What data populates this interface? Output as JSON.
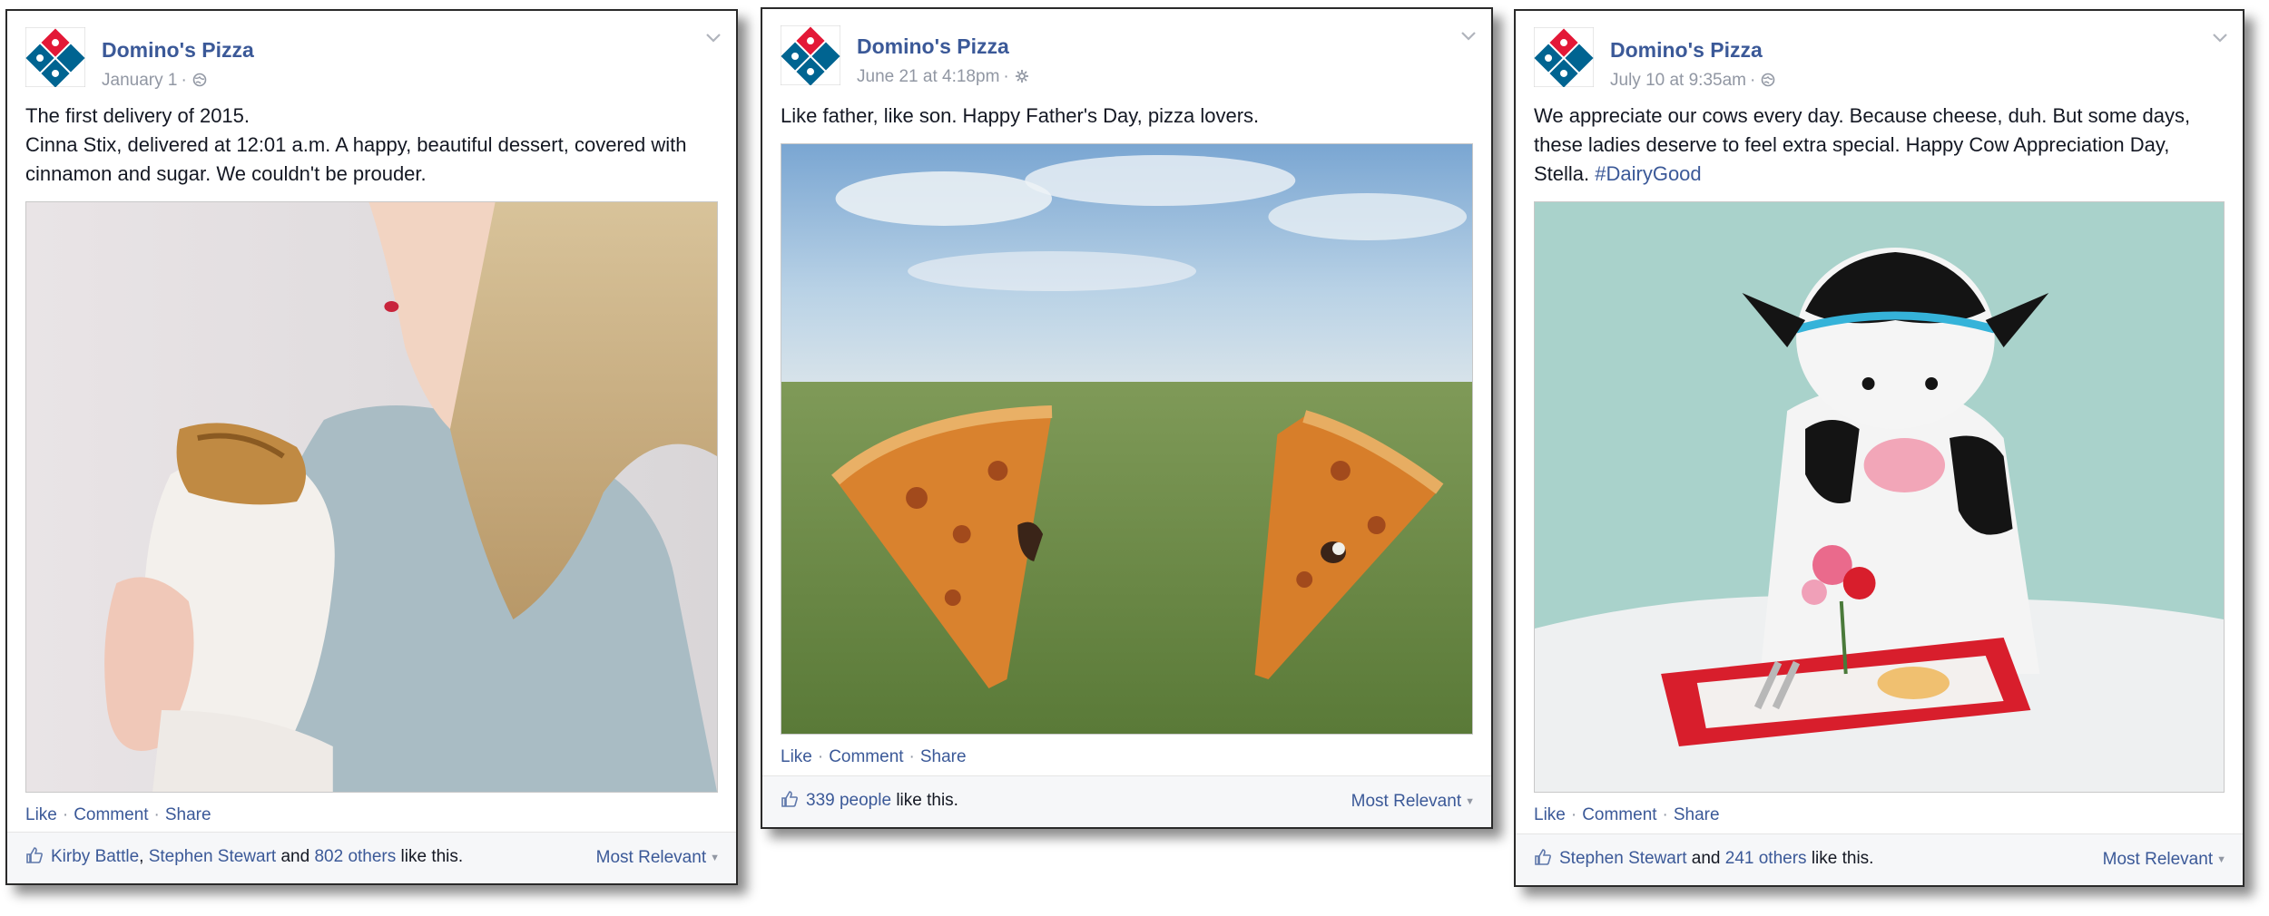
{
  "posts": [
    {
      "page_name": "Domino's Pizza",
      "date": "January 1",
      "text_lines": [
        "The first delivery of 2015.",
        "Cinna Stix, delivered at 12:01 a.m. A happy, beautiful dessert, covered with",
        "cinnamon and sugar. We couldn't be prouder."
      ],
      "actions": {
        "like": "Like",
        "comment": "Comment",
        "share": "Share"
      },
      "likes": {
        "name1": "Kirby Battle",
        "sep1": ", ",
        "name2": "Stephen Stewart",
        "and": " and ",
        "others": "802 others",
        "suffix": " like this."
      },
      "most_relevant": "Most Relevant"
    },
    {
      "page_name": "Domino's Pizza",
      "date": "June 21 at 4:18pm",
      "text_lines": [
        "Like father, like son. Happy Father's Day, pizza lovers."
      ],
      "actions": {
        "like": "Like",
        "comment": "Comment",
        "share": "Share"
      },
      "likes": {
        "people": "339 people",
        "suffix": " like this."
      },
      "most_relevant": "Most Relevant"
    },
    {
      "page_name": "Domino's Pizza",
      "date": "July 10 at 9:35am",
      "text_lines": [
        "We appreciate our cows every day. Because cheese, duh. But some days,",
        "these ladies deserve to feel extra special. Happy Cow Appreciation Day,",
        "Stella. "
      ],
      "hashtag": "#DairyGood",
      "actions": {
        "like": "Like",
        "comment": "Comment",
        "share": "Share"
      },
      "likes": {
        "name1": "Stephen Stewart",
        "and": " and ",
        "others": "241 others",
        "suffix": " like this."
      },
      "most_relevant": "Most Relevant"
    }
  ],
  "colors": {
    "link": "#3b5998",
    "meta": "#9197a3",
    "footer_bg": "#f6f7f9",
    "logo_red": "#e31837",
    "logo_blue": "#006491"
  },
  "icons": [
    "dominos-logo",
    "globe-icon",
    "gear-icon",
    "chevron-down-icon",
    "thumbs-up-icon"
  ]
}
